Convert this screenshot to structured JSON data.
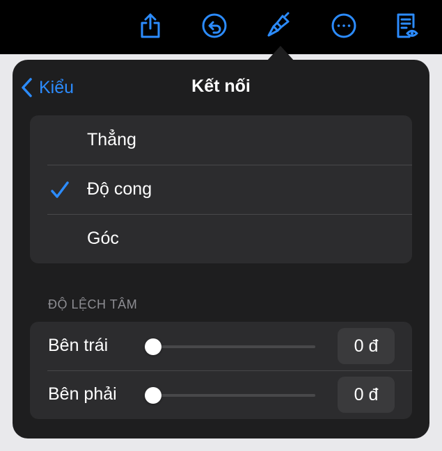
{
  "colors": {
    "accent": "#2c8cff",
    "popover_bg": "#1e1e1f",
    "group_bg": "#2c2c2e",
    "section_text": "#8e8e93"
  },
  "toolbar": {
    "buttons": [
      {
        "icon": "share-icon"
      },
      {
        "icon": "undo-icon"
      },
      {
        "icon": "format-paintbrush-icon"
      },
      {
        "icon": "more-icon"
      },
      {
        "icon": "reading-view-icon"
      }
    ]
  },
  "popover": {
    "back_label": "Kiểu",
    "title": "Kết nối",
    "options": [
      {
        "label": "Thẳng",
        "selected": false
      },
      {
        "label": "Độ cong",
        "selected": true
      },
      {
        "label": "Góc",
        "selected": false
      }
    ],
    "section_title": "ĐỘ LỆCH TÂM",
    "offsets": [
      {
        "label": "Bên trái",
        "value_text": "0 đ",
        "slider_fraction": 0.0
      },
      {
        "label": "Bên phải",
        "value_text": "0 đ",
        "slider_fraction": 0.0
      }
    ]
  }
}
